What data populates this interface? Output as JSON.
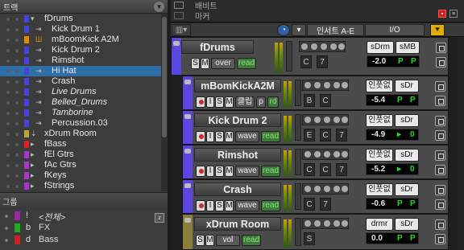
{
  "left_panel": {
    "title": "트랙",
    "tracks": [
      {
        "name": "fDrums",
        "color": "#4444dd",
        "indent": 0,
        "icon": "folder-open",
        "italic": false
      },
      {
        "name": "Kick Drum 1",
        "color": "#4444dd",
        "indent": 1,
        "icon": "audio",
        "italic": false
      },
      {
        "name": "mBoomKick A2M",
        "color": "#e08a00",
        "indent": 1,
        "icon": "midi",
        "italic": false
      },
      {
        "name": "Kick Drum 2",
        "color": "#4444dd",
        "indent": 1,
        "icon": "audio",
        "italic": false
      },
      {
        "name": "Rimshot",
        "color": "#4444dd",
        "indent": 1,
        "icon": "audio",
        "italic": false
      },
      {
        "name": "Hi Hat",
        "color": "#4444dd",
        "indent": 1,
        "icon": "audio",
        "italic": false,
        "selected": true
      },
      {
        "name": "Crash",
        "color": "#4444dd",
        "indent": 1,
        "icon": "audio",
        "italic": false
      },
      {
        "name": "Live Drums",
        "color": "#4444dd",
        "indent": 1,
        "icon": "audio",
        "italic": true
      },
      {
        "name": "Belled_Drums",
        "color": "#4444dd",
        "indent": 1,
        "icon": "audio",
        "italic": true
      },
      {
        "name": "Tamborine",
        "color": "#4444dd",
        "indent": 1,
        "icon": "audio",
        "italic": true
      },
      {
        "name": "Percussion.03",
        "color": "#4444dd",
        "indent": 1,
        "icon": "audio",
        "italic": false
      },
      {
        "name": "xDrum Room",
        "color": "#b6a63b",
        "indent": 0,
        "icon": "aux",
        "italic": false
      },
      {
        "name": "fBass",
        "color": "#dd2222",
        "indent": 0,
        "icon": "folder",
        "italic": false
      },
      {
        "name": "fEl Gtrs",
        "color": "#aa33cc",
        "indent": 0,
        "icon": "folder",
        "italic": false
      },
      {
        "name": "fAc Gtrs",
        "color": "#aa33cc",
        "indent": 0,
        "icon": "folder",
        "italic": false
      },
      {
        "name": "fKeys",
        "color": "#aa33cc",
        "indent": 0,
        "icon": "folder",
        "italic": false
      },
      {
        "name": "fStrings",
        "color": "#aa33cc",
        "indent": 0,
        "icon": "folder",
        "italic": false
      }
    ],
    "groups_title": "그룹",
    "z_label": "z",
    "groups": [
      {
        "key": "!",
        "name": "<전체>",
        "color": "#9a2aa0",
        "italic": true
      },
      {
        "key": "b",
        "name": "FX",
        "color": "#22aa22",
        "italic": false
      },
      {
        "key": "d",
        "name": "Bass",
        "color": "#cc2222",
        "italic": false
      }
    ]
  },
  "top": {
    "label1": "배비트",
    "label2": "마커"
  },
  "header": {
    "insert_label": "인서트 A-E",
    "io_label": "I/O"
  },
  "strips": [
    {
      "name": "fDrums",
      "color": "#5a46e0",
      "solo": "S",
      "mute": "M",
      "mode": "over",
      "read": "read",
      "k1": "C",
      "k2": "7",
      "io1": "sDrm",
      "io2": "sMB",
      "vol": "-2.0",
      "p1": "P",
      "p2": "P",
      "icon": "folder"
    },
    {
      "name": "mBomKickA2M",
      "color": "#5a46e0",
      "rec": "",
      "input": "I",
      "solo": "S",
      "mute": "M",
      "mode": "클립",
      "extra": "p",
      "read": "rd",
      "k1": "B",
      "k2": "C",
      "io1": "인풋없",
      "io2": "sDr",
      "vol": "-5.4",
      "p1": "P",
      "p2": "P",
      "icon": "midi"
    },
    {
      "name": "Kick Drum 2",
      "color": "#5a46e0",
      "rec": "",
      "input": "I",
      "solo": "S",
      "mute": "M",
      "mode": "wave",
      "read": "read",
      "k1": "E",
      "k2": "C",
      "k3": "7",
      "io1": "인풋없",
      "io2": "sDr",
      "vol": "-4.9",
      "p1": "▸",
      "p2": "0",
      "icon": "audio"
    },
    {
      "name": "Rimshot",
      "color": "#5a46e0",
      "rec": "",
      "input": "I",
      "solo": "S",
      "mute": "M",
      "mode": "wave",
      "read": "read",
      "k1": "C",
      "k2": "C",
      "k3": "7",
      "io1": "인풋없",
      "io2": "sDr",
      "vol": "-5.2",
      "p1": "▸",
      "p2": "0",
      "icon": "audio"
    },
    {
      "name": "Crash",
      "color": "#5a46e0",
      "rec": "",
      "input": "I",
      "solo": "S",
      "mute": "M",
      "mode": "wave",
      "read": "read",
      "k1": "C",
      "k2": "7",
      "io1": "인풋없",
      "io2": "sDr",
      "vol": "-0.6",
      "p1": "P",
      "p2": "P",
      "icon": "audio"
    },
    {
      "name": "xDrum Room",
      "color": "#8a7e3a",
      "solo": "S",
      "mute": "M",
      "mode": "vol",
      "read": "read",
      "k1": "S",
      "io1": "drmr",
      "io2": "sDr",
      "vol": "0.0",
      "p1": "P",
      "p2": "P",
      "icon": "aux"
    }
  ]
}
